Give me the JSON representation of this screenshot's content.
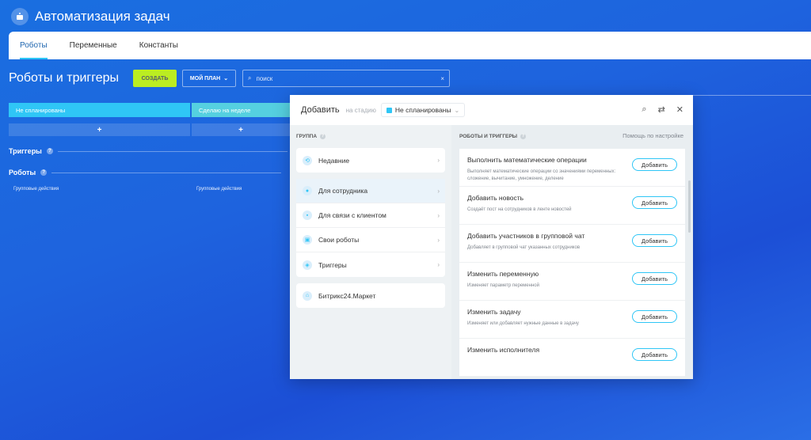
{
  "app": {
    "title": "Автоматизация задач"
  },
  "tabs": [
    "Роботы",
    "Переменные",
    "Константы"
  ],
  "header": {
    "title": "Роботы и триггеры",
    "create_label": "СОЗДАТЬ",
    "plan_label": "МОЙ ПЛАН",
    "search_placeholder": "поиск"
  },
  "stages": [
    "Не спланированы",
    "Сделаю на неделе"
  ],
  "sections": {
    "triggers": "Триггеры",
    "robots": "Роботы",
    "group_actions": "Групповые действия"
  },
  "modal": {
    "title": "Добавить",
    "stage_label": "на стадию",
    "stage_value": "Не спланированы",
    "group_header": "ГРУППА",
    "robots_header": "РОБОТЫ И ТРИГГЕРЫ",
    "help_link": "Помощь по настройке",
    "groups": [
      "Недавние",
      "Для сотрудника",
      "Для связи с клиентом",
      "Свои роботы",
      "Триггеры"
    ],
    "market": "Битрикс24.Маркет",
    "add_label": "Добавить",
    "robots": [
      {
        "title": "Выполнить математические операции",
        "desc": "Выполняет математические операции со значениями переменных: сложение, вычитание, умножение, деление"
      },
      {
        "title": "Добавить новость",
        "desc": "Создаёт пост на сотрудников в ленте новостей"
      },
      {
        "title": "Добавить участников в групповой чат",
        "desc": "Добавляет в групповой чат указанных сотрудников"
      },
      {
        "title": "Изменить переменную",
        "desc": "Изменяет параметр переменной"
      },
      {
        "title": "Изменить задачу",
        "desc": "Изменяет или добавляет нужные данные в задачу"
      },
      {
        "title": "Изменить исполнителя",
        "desc": ""
      }
    ]
  }
}
